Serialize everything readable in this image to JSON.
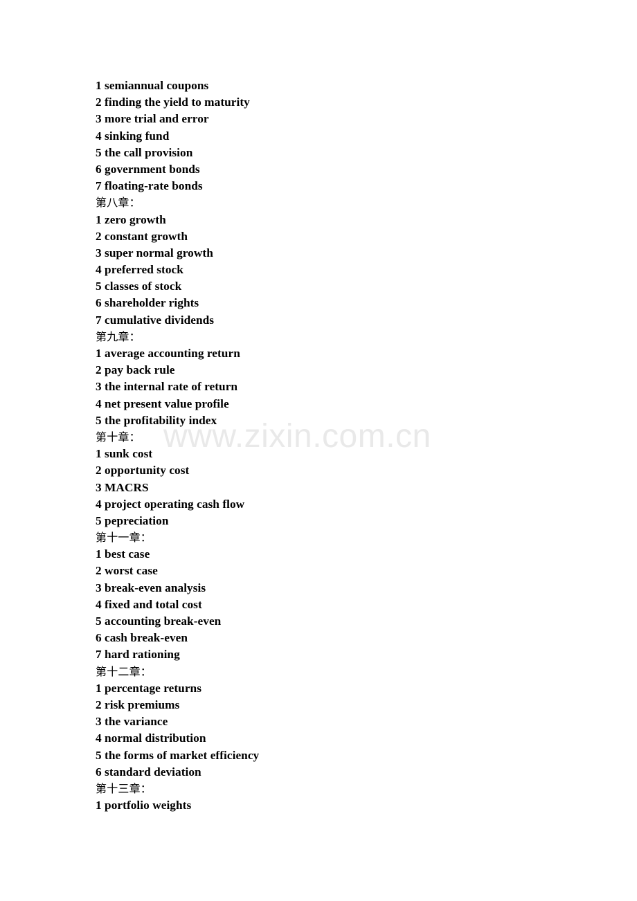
{
  "document": {
    "watermark": "www.zixin.com.cn",
    "lines": [
      {
        "type": "entry",
        "text": "1 semiannual coupons"
      },
      {
        "type": "entry",
        "text": "2 finding the yield to maturity"
      },
      {
        "type": "entry",
        "text": "3 more trial and error"
      },
      {
        "type": "entry",
        "text": "4 sinking fund"
      },
      {
        "type": "entry",
        "text": "5 the call provision"
      },
      {
        "type": "entry",
        "text": "6 government bonds"
      },
      {
        "type": "entry",
        "text": "7 floating-rate bonds"
      },
      {
        "type": "chapter",
        "text": "第八章："
      },
      {
        "type": "entry",
        "text": "1 zero growth"
      },
      {
        "type": "entry",
        "text": "2 constant growth"
      },
      {
        "type": "entry",
        "text": "3 super normal growth"
      },
      {
        "type": "entry",
        "text": "4 preferred stock"
      },
      {
        "type": "entry",
        "text": "5 classes of stock"
      },
      {
        "type": "entry",
        "text": "6 shareholder rights"
      },
      {
        "type": "entry",
        "text": "7 cumulative dividends"
      },
      {
        "type": "chapter",
        "text": "第九章："
      },
      {
        "type": "entry",
        "text": "1 average accounting return"
      },
      {
        "type": "entry",
        "text": "2 pay back rule"
      },
      {
        "type": "entry",
        "text": "3 the internal rate of return"
      },
      {
        "type": "entry",
        "text": "4 net present value profile"
      },
      {
        "type": "entry",
        "text": "5 the profitability index"
      },
      {
        "type": "chapter",
        "text": "第十章："
      },
      {
        "type": "entry",
        "text": "1 sunk cost"
      },
      {
        "type": "entry",
        "text": "2 opportunity cost"
      },
      {
        "type": "entry",
        "text": "3 MACRS"
      },
      {
        "type": "entry",
        "text": "4 project operating cash flow"
      },
      {
        "type": "entry",
        "text": "5 pepreciation"
      },
      {
        "type": "chapter",
        "text": "第十一章："
      },
      {
        "type": "entry",
        "text": "1 best case"
      },
      {
        "type": "entry",
        "text": "2 worst case"
      },
      {
        "type": "entry",
        "text": "3 break-even analysis"
      },
      {
        "type": "entry",
        "text": "4 fixed and total cost"
      },
      {
        "type": "entry",
        "text": "5 accounting break-even"
      },
      {
        "type": "entry",
        "text": "6 cash break-even"
      },
      {
        "type": "entry",
        "text": "7 hard rationing"
      },
      {
        "type": "chapter",
        "text": "第十二章："
      },
      {
        "type": "entry",
        "text": "1 percentage returns"
      },
      {
        "type": "entry",
        "text": "2 risk premiums"
      },
      {
        "type": "entry",
        "text": "3 the variance"
      },
      {
        "type": "entry",
        "text": "4 normal distribution"
      },
      {
        "type": "entry",
        "text": "5 the forms of market efficiency"
      },
      {
        "type": "entry",
        "text": "6 standard deviation"
      },
      {
        "type": "chapter",
        "text": "第十三章："
      },
      {
        "type": "entry",
        "text": "1 portfolio weights"
      }
    ]
  },
  "colors": {
    "text": "#000000",
    "watermark": "#e9e9e9",
    "page_background": "#ffffff"
  }
}
